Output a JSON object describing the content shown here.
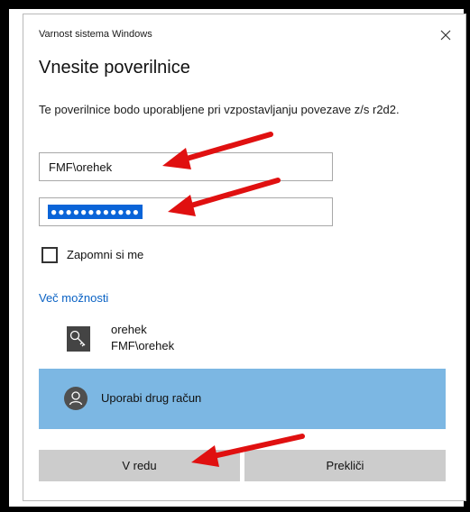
{
  "dialog": {
    "title": "Varnost sistema Windows",
    "heading": "Vnesite poverilnice",
    "description": "Te poverilnice bodo uporabljene pri vzpostavljanju povezave z/s r2d2.",
    "username_value": "FMF\\orehek",
    "password_mask": "●●●●●●●●●●●●",
    "remember_label": "Zapomni si me",
    "remember_checked": false,
    "more_options": "Več možnosti",
    "account_name": "orehek",
    "account_domain": "FMF\\orehek",
    "other_account": "Uporabi drug račun",
    "ok_label": "V redu",
    "cancel_label": "Prekliči"
  },
  "colors": {
    "accent": "#0a64d8",
    "link": "#0a62c4",
    "selected_row": "#7cb7e3",
    "annotation_arrow": "#e01010"
  },
  "icons": [
    "close-icon",
    "key-icon",
    "user-icon"
  ]
}
